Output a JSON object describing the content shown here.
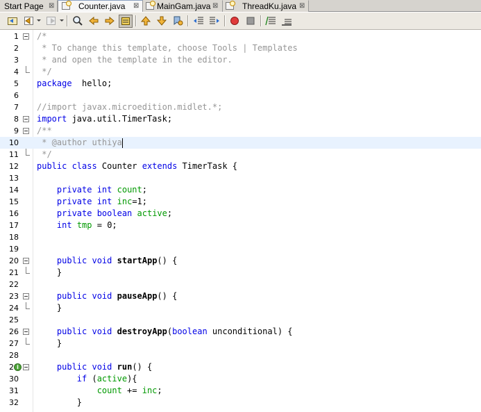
{
  "tabs": [
    {
      "label": "Start Page",
      "close": "⊠",
      "icon": "none",
      "active": false
    },
    {
      "label": "Counter.java",
      "close": "⊠",
      "icon": "java-file-icon",
      "active": true
    },
    {
      "label": "MainGam.java",
      "close": "⊠",
      "icon": "java-file-icon",
      "active": false
    },
    {
      "label": "ThreadKu.java",
      "close": "⊠",
      "icon": "java-file-icon",
      "active": false
    }
  ],
  "toolbar": {
    "buttons": [
      "last-edit-icon",
      "back-icon",
      "forward-icon",
      "find-icon",
      "find-previous-icon",
      "find-next-icon",
      "toggle-highlight-search-icon",
      "previous-bookmark-icon",
      "next-bookmark-icon",
      "toggle-bookmark-icon",
      "shift-left-icon",
      "shift-right-icon",
      "start-macro-icon",
      "stop-macro-icon",
      "comment-icon",
      "uncomment-icon"
    ]
  },
  "editor": {
    "current_line": 10,
    "lines": [
      {
        "n": "1",
        "fold": "open",
        "segs": [
          [
            "cm",
            "/*"
          ]
        ]
      },
      {
        "n": "2",
        "fold": "",
        "segs": [
          [
            "cm",
            " * To change this template, choose Tools | Templates"
          ]
        ]
      },
      {
        "n": "3",
        "fold": "",
        "segs": [
          [
            "cm",
            " * and open the template in the editor."
          ]
        ]
      },
      {
        "n": "4",
        "fold": "end",
        "segs": [
          [
            "cm",
            " */"
          ]
        ]
      },
      {
        "n": "5",
        "fold": "",
        "segs": [
          [
            "kw",
            "package"
          ],
          [
            "",
            "  hello;"
          ]
        ]
      },
      {
        "n": "6",
        "fold": "",
        "segs": []
      },
      {
        "n": "7",
        "fold": "",
        "segs": [
          [
            "cm",
            "//import javax.microedition.midlet.*;"
          ]
        ]
      },
      {
        "n": "8",
        "fold": "open",
        "segs": [
          [
            "kw",
            "import"
          ],
          [
            "",
            " java.util.TimerTask;"
          ]
        ]
      },
      {
        "n": "9",
        "fold": "open",
        "segs": [
          [
            "cm",
            "/**"
          ]
        ]
      },
      {
        "n": "10",
        "fold": "",
        "segs": [
          [
            "cm",
            " * @author uthiya"
          ]
        ]
      },
      {
        "n": "11",
        "fold": "end",
        "segs": [
          [
            "cm",
            " */"
          ]
        ]
      },
      {
        "n": "12",
        "fold": "",
        "segs": [
          [
            "kw",
            "public class"
          ],
          [
            "",
            " Counter "
          ],
          [
            "kw",
            "extends"
          ],
          [
            "",
            " TimerTask {"
          ]
        ]
      },
      {
        "n": "13",
        "fold": "",
        "segs": []
      },
      {
        "n": "14",
        "fold": "",
        "segs": [
          [
            "",
            "    "
          ],
          [
            "kw",
            "private int"
          ],
          [
            "",
            " "
          ],
          [
            "fld",
            "count"
          ],
          [
            "",
            ";"
          ]
        ]
      },
      {
        "n": "15",
        "fold": "",
        "segs": [
          [
            "",
            "    "
          ],
          [
            "kw",
            "private int"
          ],
          [
            "",
            " "
          ],
          [
            "fld",
            "inc"
          ],
          [
            "",
            "=1;"
          ]
        ]
      },
      {
        "n": "16",
        "fold": "",
        "segs": [
          [
            "",
            "    "
          ],
          [
            "kw",
            "private boolean"
          ],
          [
            "",
            " "
          ],
          [
            "fld",
            "active"
          ],
          [
            "",
            ";"
          ]
        ]
      },
      {
        "n": "17",
        "fold": "",
        "segs": [
          [
            "",
            "    "
          ],
          [
            "kw",
            "int"
          ],
          [
            "",
            " "
          ],
          [
            "fld",
            "tmp"
          ],
          [
            "",
            " = 0;"
          ]
        ]
      },
      {
        "n": "18",
        "fold": "",
        "segs": []
      },
      {
        "n": "19",
        "fold": "",
        "segs": []
      },
      {
        "n": "20",
        "fold": "open",
        "segs": [
          [
            "",
            "    "
          ],
          [
            "kw",
            "public void"
          ],
          [
            "",
            " "
          ],
          [
            "bold",
            "startApp"
          ],
          [
            "",
            "() {"
          ]
        ]
      },
      {
        "n": "21",
        "fold": "end",
        "segs": [
          [
            "",
            "    }"
          ]
        ]
      },
      {
        "n": "22",
        "fold": "",
        "segs": []
      },
      {
        "n": "23",
        "fold": "open",
        "segs": [
          [
            "",
            "    "
          ],
          [
            "kw",
            "public void"
          ],
          [
            "",
            " "
          ],
          [
            "bold",
            "pauseApp"
          ],
          [
            "",
            "() {"
          ]
        ]
      },
      {
        "n": "24",
        "fold": "end",
        "segs": [
          [
            "",
            "    }"
          ]
        ]
      },
      {
        "n": "25",
        "fold": "",
        "segs": []
      },
      {
        "n": "26",
        "fold": "open",
        "segs": [
          [
            "",
            "    "
          ],
          [
            "kw",
            "public void"
          ],
          [
            "",
            " "
          ],
          [
            "bold",
            "destroyApp"
          ],
          [
            "",
            "("
          ],
          [
            "kw",
            "boolean"
          ],
          [
            "",
            " unconditional) {"
          ]
        ]
      },
      {
        "n": "27",
        "fold": "end",
        "segs": [
          [
            "",
            "    }"
          ]
        ]
      },
      {
        "n": "28",
        "fold": "",
        "segs": []
      },
      {
        "n": "29",
        "fold": "open",
        "badge": true,
        "segs": [
          [
            "",
            "    "
          ],
          [
            "kw",
            "public void"
          ],
          [
            "",
            " "
          ],
          [
            "bold",
            "run"
          ],
          [
            "",
            "() {"
          ]
        ]
      },
      {
        "n": "30",
        "fold": "",
        "segs": [
          [
            "",
            "        "
          ],
          [
            "kw",
            "if"
          ],
          [
            "",
            " ("
          ],
          [
            "fld",
            "active"
          ],
          [
            "",
            "){"
          ]
        ]
      },
      {
        "n": "31",
        "fold": "",
        "segs": [
          [
            "",
            "            "
          ],
          [
            "fld",
            "count"
          ],
          [
            "",
            " += "
          ],
          [
            "fld",
            "inc"
          ],
          [
            "",
            ";"
          ]
        ]
      },
      {
        "n": "32",
        "fold": "",
        "segs": [
          [
            "",
            "        }"
          ]
        ]
      }
    ]
  }
}
